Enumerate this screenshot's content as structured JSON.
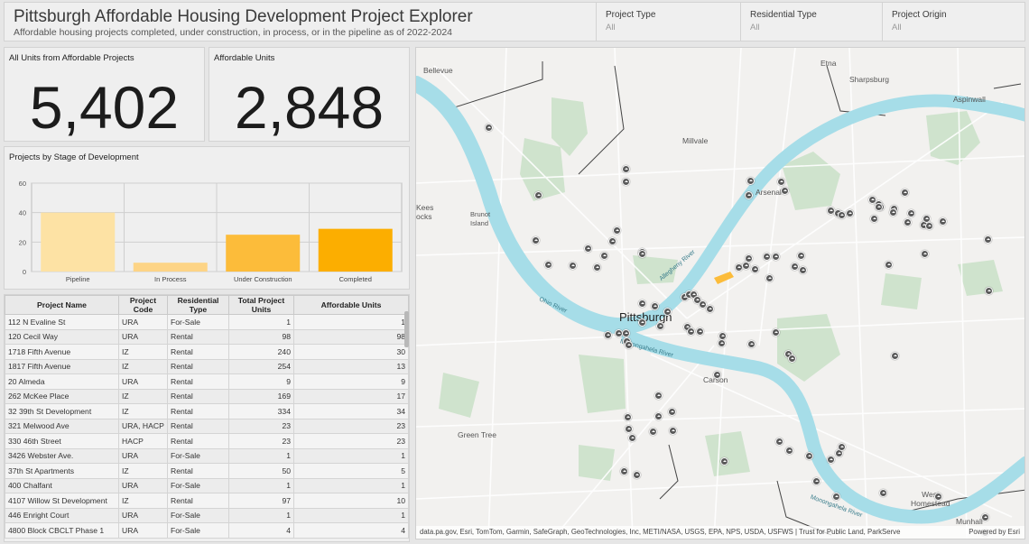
{
  "header": {
    "title": "Pittsburgh Affordable Housing Development Project Explorer",
    "subtitle": "Affordable housing projects completed, under construction, in process, or in the pipeline as of 2022-2024"
  },
  "filters": [
    {
      "label": "Project Type",
      "value": "All"
    },
    {
      "label": "Residential Type",
      "value": "All"
    },
    {
      "label": "Project Origin",
      "value": "All"
    }
  ],
  "indicators": {
    "all_units": {
      "title": "All Units from Affordable Projects",
      "value": "5,402"
    },
    "affordable_units": {
      "title": "Affordable Units",
      "value": "2,848"
    }
  },
  "chart_title": "Projects by Stage of Development",
  "chart_data": {
    "type": "bar",
    "categories": [
      "Pipeline",
      "In Process",
      "Under Construction",
      "Completed"
    ],
    "values": [
      40,
      6,
      25,
      29
    ],
    "ylim": [
      0,
      60
    ],
    "yticks": [
      0,
      20,
      40,
      60
    ],
    "colors": [
      "#fde2a4",
      "#fdd486",
      "#fcbc3a",
      "#fcae00"
    ],
    "grid": true
  },
  "table": {
    "columns": [
      "Project Name",
      "Project Code",
      "Residential Type",
      "Total Project Units",
      "Affordable Units"
    ],
    "rows": [
      [
        "112 N Evaline St",
        "URA",
        "For-Sale",
        "1",
        "1"
      ],
      [
        "120 Cecil Way",
        "URA",
        "Rental",
        "98",
        "98"
      ],
      [
        "1718 Fifth Avenue",
        "IZ",
        "Rental",
        "240",
        "30"
      ],
      [
        "1817 Fifth Avenue",
        "IZ",
        "Rental",
        "254",
        "13"
      ],
      [
        "20 Almeda",
        "URA",
        "Rental",
        "9",
        "9"
      ],
      [
        "262 McKee Place",
        "IZ",
        "Rental",
        "169",
        "17"
      ],
      [
        "32 39th St Development",
        "IZ",
        "Rental",
        "334",
        "34"
      ],
      [
        "321 Melwood Ave",
        "URA, HACP",
        "Rental",
        "23",
        "23"
      ],
      [
        "330 46th Street",
        "HACP",
        "Rental",
        "23",
        "23"
      ],
      [
        "3426 Webster Ave.",
        "URA",
        "For-Sale",
        "1",
        "1"
      ],
      [
        "37th St Apartments",
        "IZ",
        "Rental",
        "50",
        "5"
      ],
      [
        "400 Chalfant",
        "URA",
        "For-Sale",
        "1",
        "1"
      ],
      [
        "4107 Willow St Development",
        "IZ",
        "Rental",
        "97",
        "10"
      ],
      [
        "446 Enright Court",
        "URA",
        "For-Sale",
        "1",
        "1"
      ],
      [
        "4800 Block CBCLT Phase 1",
        "URA",
        "For-Sale",
        "4",
        "4"
      ]
    ]
  },
  "map": {
    "labels": {
      "bellevue": "Bellevue",
      "etna": "Etna",
      "sharpsburg": "Sharpsburg",
      "aspinwall": "Aspinwall",
      "millvale": "Millvale",
      "arsenal": "Arsenal",
      "mckees_rocks": "Kees\nocks",
      "brunot": "Brunot\nIsland",
      "pittsburgh": "Pittsburgh",
      "carson": "Carson",
      "green_tree": "Green Tree",
      "west_homestead": "West\nHomestead",
      "munhall": "Munhall",
      "ohio_river": "Ohio River",
      "allegheny_river": "Allegheny River",
      "mon_river": "Monongahela River",
      "mon_river2": "Monongahela River"
    },
    "attribution": "data.pa.gov, Esri, TomTom, Garmin, SafeGraph, GeoTechnologies, Inc, METI/NASA, USGS, EPA, NPS, USDA, USFWS | Trust for Public Land, ParkServe",
    "powered_by": "Powered by Esri",
    "marker_icon": "house-icon",
    "colors": {
      "water": "#a6dde8",
      "park": "#cfe3cd",
      "road": "#ffffff",
      "marker": "#5a5a5a"
    }
  }
}
